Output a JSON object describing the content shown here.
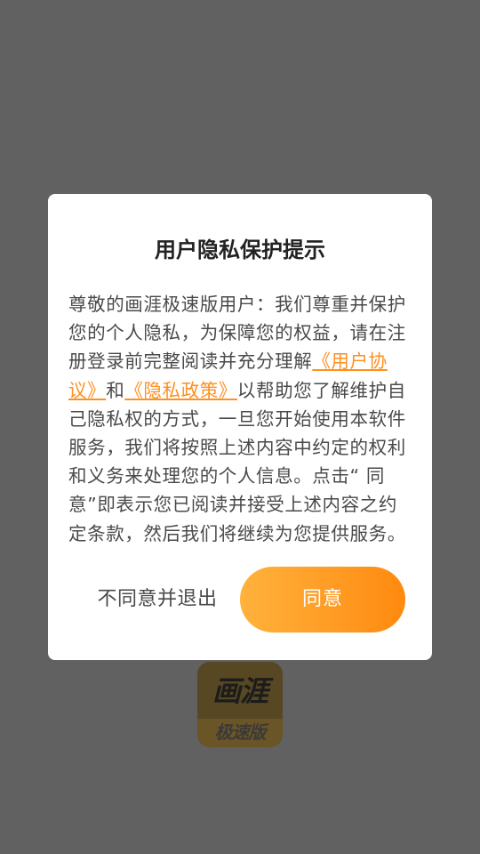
{
  "dialog": {
    "title": "用户隐私保护提示",
    "body_part1": "尊敬的画涯极速版用户：我们尊重并保护您的个人隐私，为保障您的权益，请在注册登录前完整阅读并充分理解",
    "user_agreement_link": "《用户协议》",
    "conjunction": "和",
    "privacy_policy_link": "《隐私政策》",
    "body_part2": "以帮助您了解维护自己隐私权的方式，一旦您开始使用本软件服务，我们将按照上述内容中约定的权利和义务来处理您的个人信息。点击“ 同意”即表示您已阅读并接受上述内容之约定条款，然后我们将继续为您提供服务。",
    "decline_label": "不同意并退出",
    "agree_label": "同意"
  },
  "logo": {
    "top_text": "画涯",
    "bottom_text": "极速版"
  },
  "colors": {
    "overlay": "#616161",
    "dialog_bg": "#ffffff",
    "link": "#ff8f1f",
    "agree_gradient_start": "#ffb23c",
    "agree_gradient_end": "#ff8a0f",
    "logo_bg": "#574722"
  }
}
